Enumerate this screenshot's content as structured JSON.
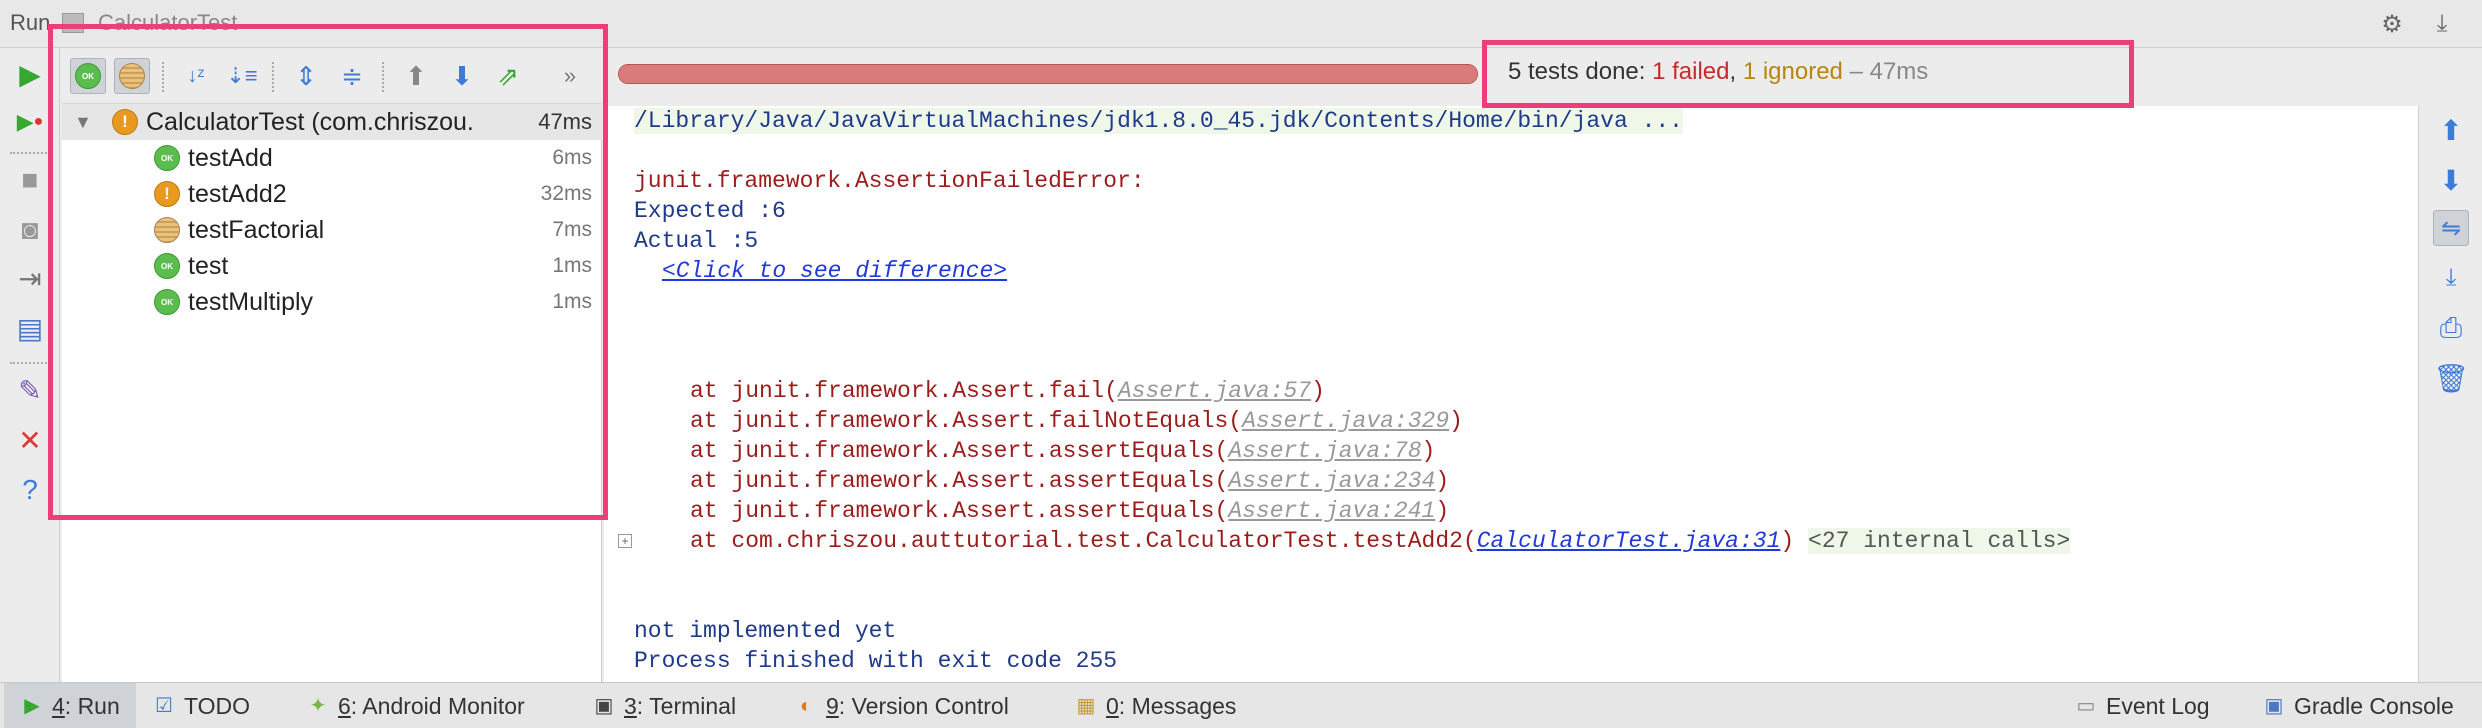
{
  "titlebar": {
    "run_label": "Run",
    "config_name": "CalculatorTest",
    "settings_icon": "gear-icon",
    "hide_icon": "hide-down-icon"
  },
  "tree": {
    "root": {
      "label": "CalculatorTest (com.chriszou.",
      "time": "47ms",
      "status": "failed"
    },
    "items": [
      {
        "label": "testAdd",
        "time": "6ms",
        "status": "passed",
        "badge": "OK"
      },
      {
        "label": "testAdd2",
        "time": "32ms",
        "status": "failed",
        "badge": "!"
      },
      {
        "label": "testFactorial",
        "time": "7ms",
        "status": "ignored",
        "badge": ""
      },
      {
        "label": "test",
        "time": "1ms",
        "status": "passed",
        "badge": "OK"
      },
      {
        "label": "testMultiply",
        "time": "1ms",
        "status": "passed",
        "badge": "OK"
      }
    ],
    "ok_badge": "OK"
  },
  "progress": {
    "fraction": 1.0,
    "color": "#d97b7b"
  },
  "summary": {
    "done": "5 tests done: ",
    "failed": "1 failed",
    "sep": ", ",
    "ignored": "1 ignored",
    "duration": " – 47ms"
  },
  "console": {
    "command": "/Library/Java/JavaVirtualMachines/jdk1.8.0_45.jdk/Contents/Home/bin/java ...",
    "error_title": "junit.framework.AssertionFailedError:",
    "expected": "Expected :6",
    "actual": "Actual   :5",
    "diff_link": "<Click to see difference>",
    "stack": [
      {
        "prefix": "at junit.framework.Assert.fail(",
        "link": "Assert.java:57",
        "suffix": ")"
      },
      {
        "prefix": "at junit.framework.Assert.failNotEquals(",
        "link": "Assert.java:329",
        "suffix": ")"
      },
      {
        "prefix": "at junit.framework.Assert.assertEquals(",
        "link": "Assert.java:78",
        "suffix": ")"
      },
      {
        "prefix": "at junit.framework.Assert.assertEquals(",
        "link": "Assert.java:234",
        "suffix": ")"
      },
      {
        "prefix": "at junit.framework.Assert.assertEquals(",
        "link": "Assert.java:241",
        "suffix": ")"
      }
    ],
    "last_frame": {
      "prefix": "at com.chriszou.auttutorial.test.CalculatorTest.testAdd2(",
      "link": "CalculatorTest.java:31",
      "suffix": ")",
      "internal": "<27 internal calls>",
      "fold": "+"
    },
    "message": "not implemented yet",
    "exit": "Process finished with exit code 255"
  },
  "bottom_tabs": [
    {
      "mnemonic": "4",
      "label": ": Run",
      "icon": "run-icon",
      "active": true
    },
    {
      "mnemonic": "",
      "label": "TODO",
      "icon": "todo-icon",
      "active": false
    },
    {
      "mnemonic": "6",
      "label": ": Android Monitor",
      "icon": "android-icon",
      "active": false
    },
    {
      "mnemonic": "3",
      "label": ": Terminal",
      "icon": "terminal-icon",
      "active": false
    },
    {
      "mnemonic": "9",
      "label": ": Version Control",
      "icon": "vcs-icon",
      "active": false
    },
    {
      "mnemonic": "0",
      "label": ": Messages",
      "icon": "messages-icon",
      "active": false
    }
  ],
  "bottom_right": [
    {
      "label": "Event Log",
      "icon": "event-log-icon"
    },
    {
      "label": "Gradle Console",
      "icon": "gradle-console-icon"
    }
  ],
  "colors": {
    "highlight": "#ef3d7b",
    "passed": "#5cbd4f",
    "failed": "#e79a1f",
    "error_text": "#9c1c1c"
  }
}
